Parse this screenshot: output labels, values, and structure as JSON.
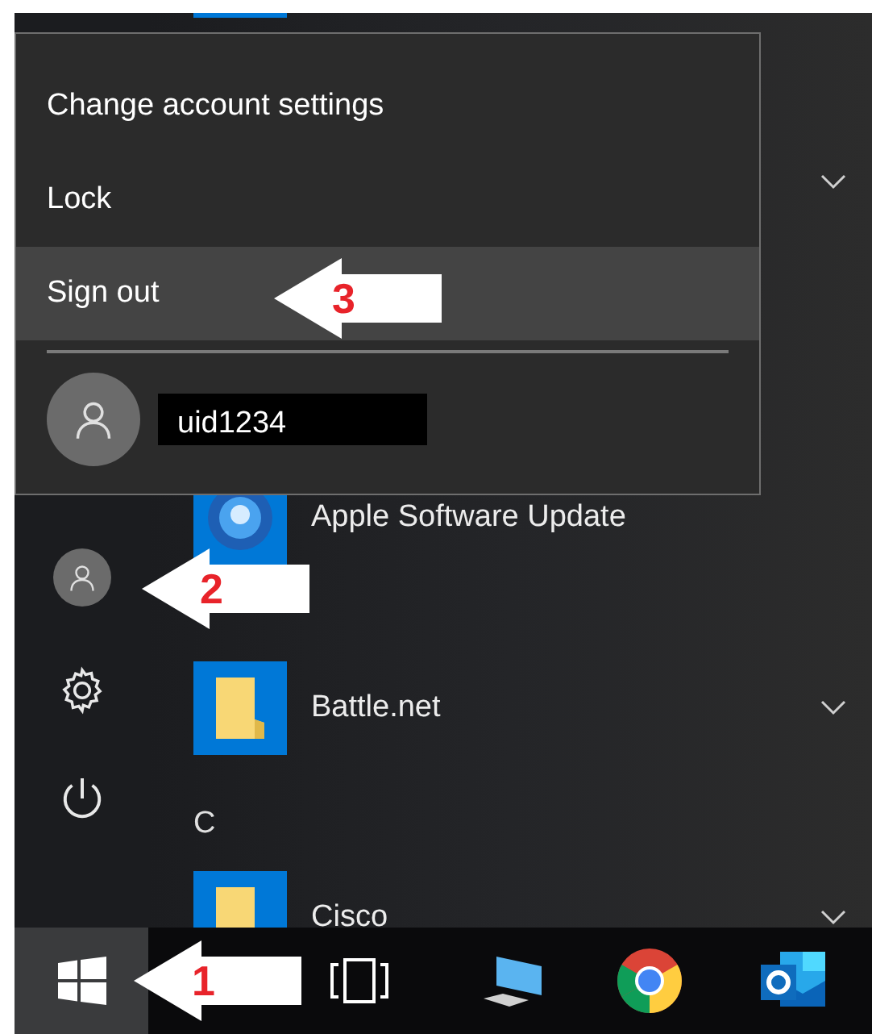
{
  "account_menu": {
    "items": [
      {
        "label": "Change account settings",
        "selected": false
      },
      {
        "label": "Lock",
        "selected": false
      },
      {
        "label": "Sign out",
        "selected": true
      }
    ],
    "user": {
      "name": "uid1234"
    }
  },
  "apps": [
    {
      "kind": "program",
      "expandable": true
    },
    {
      "kind": "program",
      "label": "Apple Software Update",
      "expandable": false
    },
    {
      "kind": "folder",
      "label": "Battle.net",
      "expandable": true
    },
    {
      "kind": "heading",
      "label": "C"
    },
    {
      "kind": "folder",
      "label": "Cisco",
      "expandable": true
    }
  ],
  "taskbar": {
    "start_selected": true
  },
  "callouts": [
    {
      "number": "1"
    },
    {
      "number": "2"
    },
    {
      "number": "3"
    }
  ]
}
